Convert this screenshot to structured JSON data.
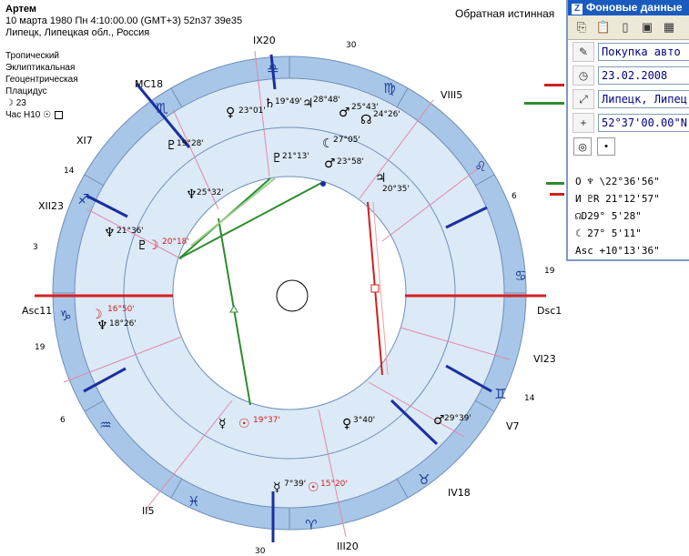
{
  "header": {
    "name": "Артем",
    "date_line": "10 марта 1980  Пн   4:10:00.00 (GMT+3) 52n37  39e35",
    "place_line": "Липецк, Липецкая обл., Россия",
    "top_right": "Обратная истинная"
  },
  "meta": {
    "zodiac": "Тропический",
    "coords": "Эклиптикальная",
    "centric": "Геоцентрическая",
    "houses": "Плацидус",
    "moon_day": "☽  23",
    "hour": "Час H10 ☉"
  },
  "panel": {
    "title": "Фоновые данные",
    "event": "Покупка авто",
    "date": "23.02.2008",
    "place": "Липецк, Липецк",
    "lat": "52°37'00.00\"N",
    "list": [
      "O ♆ \\22°36'56\"",
      "И ♇R 21°12'57\"",
      "☊D29° 5'28\"",
      "☾  27° 5'11\"",
      "Asc +10°13'36\""
    ]
  },
  "wheel": {
    "houses": [
      "IX20",
      "VIII5",
      "Dsc1",
      "VI23",
      "V7",
      "IV18",
      "III20",
      "II5",
      "Asc11",
      "XII23",
      "XI7",
      "MC18"
    ],
    "signs": [
      "♈",
      "♉",
      "♊",
      "♋",
      "♌",
      "♍",
      "♎",
      "♏",
      "♐",
      "♑",
      "♒",
      "♓"
    ],
    "degree_marks": [
      "30",
      "6",
      "19",
      "14",
      "30",
      "3",
      "19",
      "6",
      "14"
    ],
    "outer_planets": [
      "23°01'",
      "19°49'",
      "28°48'",
      "25°43'",
      "24°26'",
      "27°05'",
      "19°28'",
      "21°13'",
      "23°58'",
      "20°35'",
      "25°32'",
      "21°36'",
      "20°18'",
      "16°50'",
      "18°26'",
      "19°37'",
      "3°40'",
      "29°39'",
      "7°39'",
      "15°20'"
    ]
  },
  "colors": {
    "wheel_blue": "#a8c6e8",
    "zone_light": "#dce9f6",
    "title_blue": "#1a5bbf",
    "aspect_green": "#2e8b2e",
    "aspect_red": "#d02020"
  }
}
